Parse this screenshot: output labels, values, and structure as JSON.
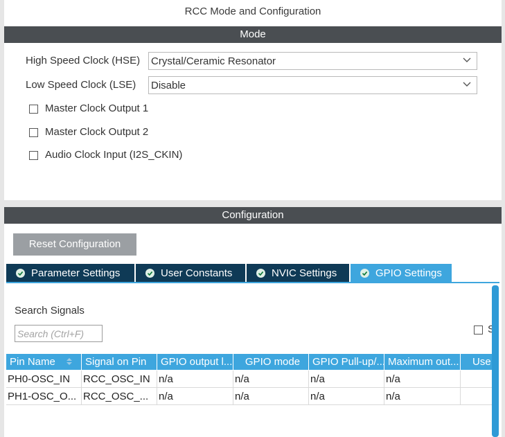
{
  "window": {
    "title": "RCC Mode and Configuration"
  },
  "mode": {
    "section_title": "Mode",
    "hse": {
      "label": "High Speed Clock (HSE)",
      "value": "Crystal/Ceramic Resonator"
    },
    "lse": {
      "label": "Low Speed Clock (LSE)",
      "value": "Disable"
    },
    "checkboxes": [
      {
        "label": "Master Clock Output 1",
        "checked": false
      },
      {
        "label": "Master Clock Output 2",
        "checked": false
      },
      {
        "label": "Audio Clock Input (I2S_CKIN)",
        "checked": false
      }
    ]
  },
  "configuration": {
    "section_title": "Configuration",
    "reset_label": "Reset Configuration",
    "tabs": [
      {
        "label": "Parameter Settings",
        "active": false
      },
      {
        "label": "User Constants",
        "active": false
      },
      {
        "label": "NVIC Settings",
        "active": false
      },
      {
        "label": "GPIO Settings",
        "active": true
      }
    ],
    "search": {
      "title": "Search Signals",
      "placeholder": "Search (Ctrl+F)",
      "show_label": "S"
    },
    "table": {
      "columns": [
        "Pin Name",
        "Signal on Pin",
        "GPIO output l...",
        "GPIO mode",
        "GPIO Pull-up/...",
        "Maximum out...",
        "Use"
      ],
      "rows": [
        [
          "PH0-OSC_IN",
          "RCC_OSC_IN",
          "n/a",
          "n/a",
          "n/a",
          "n/a",
          ""
        ],
        [
          "PH1-OSC_O...",
          "RCC_OSC_...",
          "n/a",
          "n/a",
          "n/a",
          "n/a",
          ""
        ]
      ]
    }
  },
  "colors": {
    "section_bar": "#4a4e52",
    "tab_inactive": "#0f3a56",
    "tab_active": "#3ea6de",
    "table_header": "#3ea6de",
    "button_disabled": "#9b9fa3"
  },
  "icons": {
    "dropdown": "chevron-down-icon",
    "tab_status": "check-circle-icon",
    "sort": "sort-icon"
  }
}
